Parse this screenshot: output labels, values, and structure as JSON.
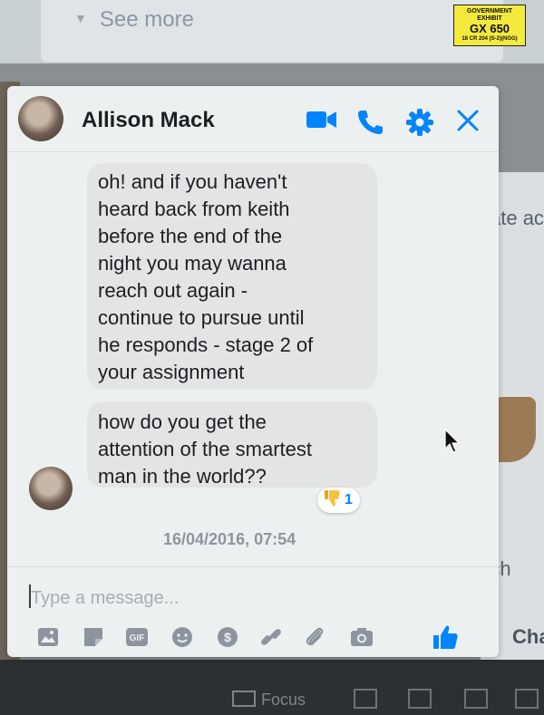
{
  "background": {
    "see_more": "See more",
    "right_text_1": "ate ac",
    "right_text_2": "etch",
    "right_text_3": "...",
    "right_text_4": "Cha",
    "taskbar_focus": "Focus"
  },
  "exhibit_sticker": {
    "line1": "GOVERNMENT",
    "line2": "EXHIBIT",
    "line3": "GX 650",
    "line4": "18 CR 204 (S-2)(NGG)"
  },
  "chat": {
    "contact_name": "Allison Mack",
    "messages": [
      {
        "lines": [
          "oh! and if you haven't",
          "heard back from keith",
          "before the end of the",
          "night you may wanna",
          "reach out again -",
          "continue to pursue until",
          "he responds - stage 2 of",
          "your assignment"
        ]
      },
      {
        "lines": [
          "how do you get the",
          "attention of the smartest",
          "man in the world??"
        ]
      }
    ],
    "reaction": {
      "icon": "thumbs-down-icon",
      "count": "1"
    },
    "timestamp": "16/04/2016, 07:54",
    "composer_placeholder": "Type a message...",
    "colors": {
      "accent": "#0084ff",
      "bubble": "#e2e4e6",
      "reaction": "#f5c33b"
    }
  }
}
